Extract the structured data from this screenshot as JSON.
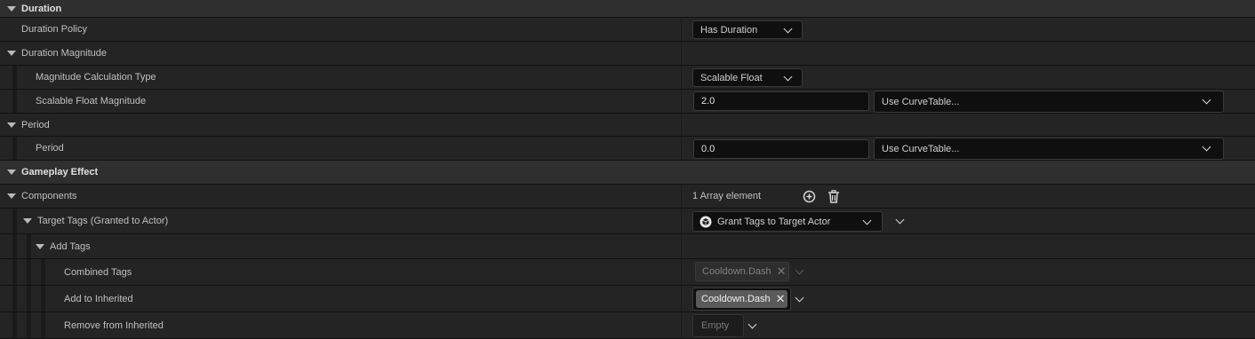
{
  "rows": {
    "duration_header": "Duration",
    "duration_policy": {
      "label": "Duration Policy",
      "value": "Has Duration"
    },
    "duration_magnitude": "Duration Magnitude",
    "magnitude_calc": {
      "label": "Magnitude Calculation Type",
      "value": "Scalable Float"
    },
    "scalable_float": {
      "label": "Scalable Float Magnitude",
      "value": "2.0",
      "curve": "Use CurveTable..."
    },
    "period_group": "Period",
    "period": {
      "label": "Period",
      "value": "0.0",
      "curve": "Use CurveTable..."
    },
    "gameplay_effect_header": "Gameplay Effect",
    "components": {
      "label": "Components",
      "value": "1 Array element"
    },
    "target_tags": {
      "label": "Target Tags (Granted to Actor)",
      "value": "Grant Tags to Target Actor"
    },
    "add_tags": "Add Tags",
    "combined_tags": {
      "label": "Combined Tags",
      "tag": "Cooldown.Dash"
    },
    "add_to_inherited": {
      "label": "Add to Inherited",
      "tag": "Cooldown.Dash"
    },
    "remove_from_inherited": {
      "label": "Remove from Inherited",
      "value": "Empty"
    }
  },
  "icons": {
    "add": "plus-circle-icon",
    "delete": "trash-icon",
    "component": "component-icon"
  },
  "colors": {
    "background": "#242424",
    "category": "#2f2f2f",
    "field": "#0f0f0f",
    "tag_active": "#5a5a5a",
    "tag_disabled": "#2e2e2e"
  }
}
